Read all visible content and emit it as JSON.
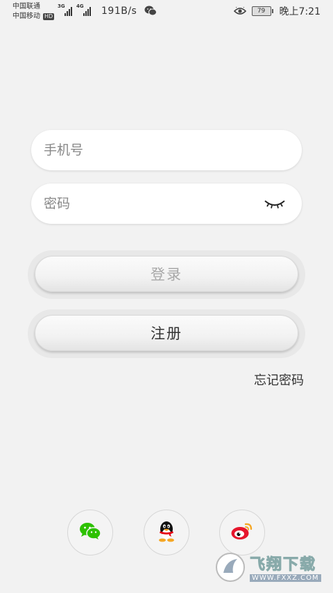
{
  "status_bar": {
    "carrier1": "中国联通",
    "carrier2": "中国移动",
    "hd_badge": "HD",
    "net1": "3G",
    "net2": "4G",
    "speed": "191B/s",
    "battery": "79",
    "time": "晚上7:21"
  },
  "form": {
    "phone_placeholder": "手机号",
    "password_placeholder": "密码"
  },
  "buttons": {
    "login": "登录",
    "register": "注册"
  },
  "links": {
    "forgot_password": "忘记密码"
  },
  "social": [
    "wechat-icon",
    "qq-icon",
    "weibo-icon"
  ],
  "watermark": {
    "title": "飞翔下载",
    "url": "WWW.FXXZ.COM"
  },
  "colors": {
    "background": "#f2f2f2",
    "wechat": "#2dc100",
    "weibo": "#e6162d",
    "disabled_text": "#a8a8a8"
  }
}
